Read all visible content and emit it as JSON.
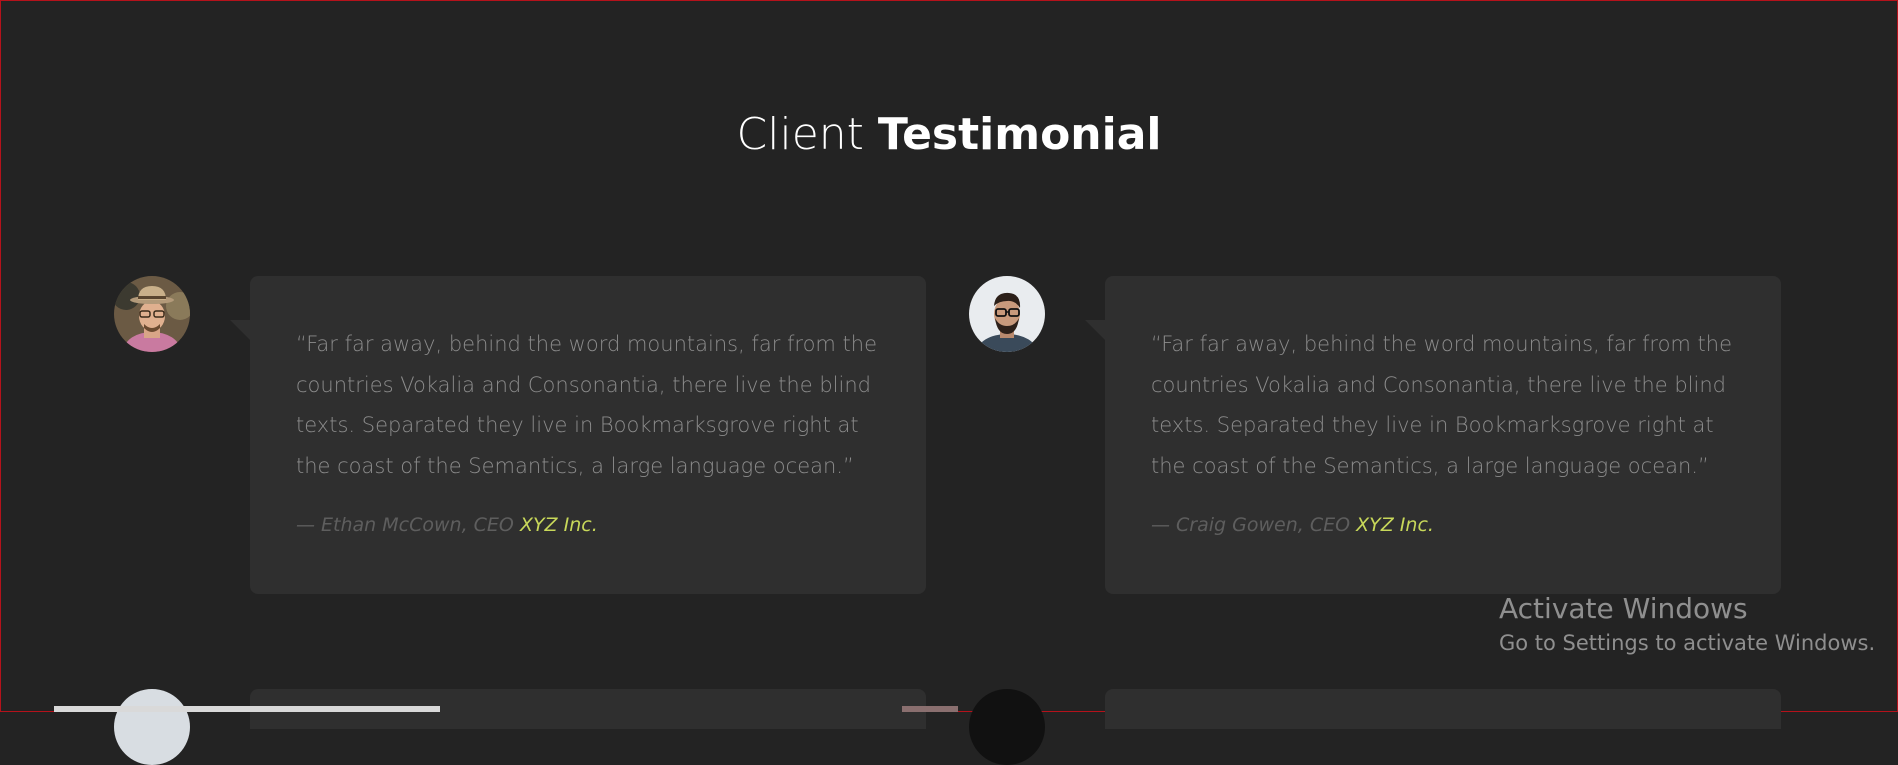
{
  "section": {
    "title_light": "Client",
    "title_bold": "Testimonial"
  },
  "testimonials": [
    {
      "quote": "“Far far away, behind the word mountains, far from the countries Vokalia and Consonantia, there live the blind texts. Separated they live in Bookmarksgrove right at the coast of the Semantics, a large language ocean.”",
      "author": "— Ethan McCown, CEO",
      "company": "XYZ Inc.",
      "avatar_icon": "person-with-hat-avatar"
    },
    {
      "quote": "“Far far away, behind the word mountains, far from the countries Vokalia and Consonantia, there live the blind texts. Separated they live in Bookmarksgrove right at the coast of the Semantics, a large language ocean.”",
      "author": "— Craig Gowen, CEO",
      "company": "XYZ Inc.",
      "avatar_icon": "bearded-man-glasses-avatar"
    }
  ],
  "watermark": {
    "title": "Activate Windows",
    "subtitle": "Go to Settings to activate Windows."
  },
  "colors": {
    "background": "#232323",
    "card": "#2f2f2f",
    "accent": "#c8d85a",
    "frame": "#b5121b"
  }
}
